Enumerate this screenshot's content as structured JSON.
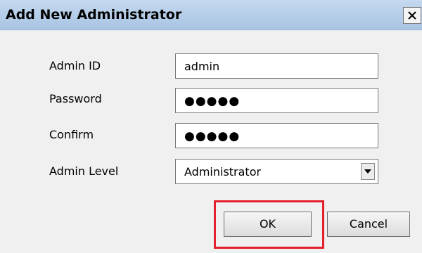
{
  "dialog": {
    "title": "Add New Administrator",
    "close_glyph": "X"
  },
  "form": {
    "admin_id": {
      "label": "Admin ID",
      "value": "admin"
    },
    "password": {
      "label": "Password",
      "value": "●●●●●"
    },
    "confirm": {
      "label": "Confirm",
      "value": "●●●●●"
    },
    "admin_level": {
      "label": "Admin Level",
      "selected": "Administrator"
    }
  },
  "buttons": {
    "ok": "OK",
    "cancel": "Cancel"
  },
  "colors": {
    "titlebar": "#b5cde8",
    "highlight": "#e3202b",
    "background": "#f0f0f0"
  },
  "icons": {
    "close": "close-icon",
    "dropdown": "chevron-down-icon"
  }
}
